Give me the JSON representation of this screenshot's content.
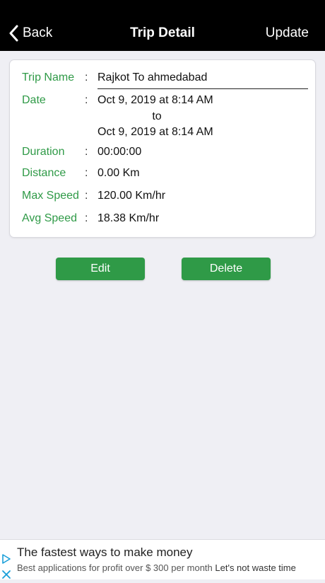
{
  "nav": {
    "back_label": "Back",
    "title": "Trip Detail",
    "update_label": "Update"
  },
  "trip": {
    "name_label": "Trip Name",
    "name_value": "Rajkot To ahmedabad",
    "date_label": "Date",
    "date_start": "Oct 9, 2019 at 8:14 AM",
    "date_to": "to",
    "date_end": "Oct 9, 2019 at 8:14 AM",
    "duration_label": "Duration",
    "duration_value": "00:00:00",
    "distance_label": "Distance",
    "distance_value": "0.00 Km",
    "max_speed_label": "Max Speed",
    "max_speed_value": "120.00 Km/hr",
    "avg_speed_label": "Avg Speed",
    "avg_speed_value": "18.38 Km/hr",
    "separator": ":"
  },
  "actions": {
    "edit_label": "Edit",
    "delete_label": "Delete"
  },
  "ad": {
    "title": "The fastest ways to make money",
    "subtitle": "Best applications for profit over $ 300 per month",
    "cta": "Let's not waste time"
  },
  "colors": {
    "accent": "#2f9a47",
    "navbar": "#000000",
    "background": "#efeff4"
  }
}
